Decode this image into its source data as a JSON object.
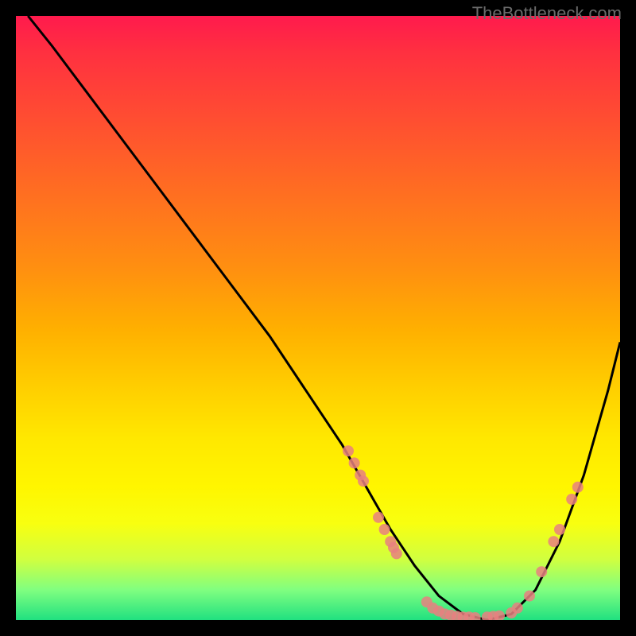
{
  "watermark": "TheBottleneck.com",
  "chart_data": {
    "type": "line",
    "title": "",
    "xlabel": "",
    "ylabel": "",
    "xlim": [
      0,
      100
    ],
    "ylim": [
      0,
      100
    ],
    "grid": false,
    "legend": false,
    "series": [
      {
        "name": "curve",
        "color": "#000000",
        "x": [
          2,
          6,
          12,
          18,
          24,
          30,
          36,
          42,
          48,
          54,
          58,
          62,
          66,
          70,
          74,
          78,
          82,
          86,
          90,
          94,
          98,
          100
        ],
        "y": [
          100,
          95,
          87,
          79,
          71,
          63,
          55,
          47,
          38,
          29,
          22,
          15,
          9,
          4,
          1,
          0,
          1,
          5,
          13,
          24,
          38,
          46
        ]
      }
    ],
    "scatter_points": {
      "name": "markers",
      "color": "#e88080",
      "points": [
        {
          "x": 55,
          "y": 28
        },
        {
          "x": 56,
          "y": 26
        },
        {
          "x": 57,
          "y": 24
        },
        {
          "x": 57.5,
          "y": 23
        },
        {
          "x": 60,
          "y": 17
        },
        {
          "x": 61,
          "y": 15
        },
        {
          "x": 62,
          "y": 13
        },
        {
          "x": 62.5,
          "y": 12
        },
        {
          "x": 63,
          "y": 11
        },
        {
          "x": 68,
          "y": 3
        },
        {
          "x": 69,
          "y": 2
        },
        {
          "x": 70,
          "y": 1.5
        },
        {
          "x": 71,
          "y": 1
        },
        {
          "x": 72,
          "y": 0.8
        },
        {
          "x": 73,
          "y": 0.6
        },
        {
          "x": 74,
          "y": 0.5
        },
        {
          "x": 75,
          "y": 0.5
        },
        {
          "x": 76,
          "y": 0.4
        },
        {
          "x": 78,
          "y": 0.5
        },
        {
          "x": 79,
          "y": 0.6
        },
        {
          "x": 80,
          "y": 0.7
        },
        {
          "x": 82,
          "y": 1.2
        },
        {
          "x": 83,
          "y": 2
        },
        {
          "x": 85,
          "y": 4
        },
        {
          "x": 87,
          "y": 8
        },
        {
          "x": 89,
          "y": 13
        },
        {
          "x": 90,
          "y": 15
        },
        {
          "x": 92,
          "y": 20
        },
        {
          "x": 93,
          "y": 22
        }
      ]
    }
  }
}
